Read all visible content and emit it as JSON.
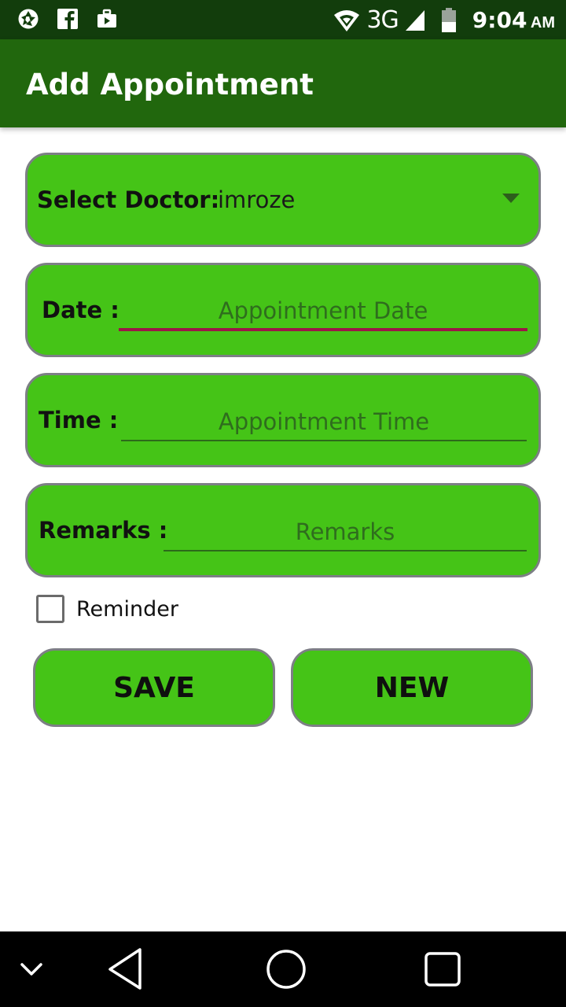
{
  "status_bar": {
    "left_icons": [
      "shutter-icon",
      "facebook-icon",
      "briefcase-icon"
    ],
    "network": "3G",
    "time": "9:04",
    "ampm": "AM",
    "right_icons": [
      "wifi-icon",
      "signal-icon",
      "battery-icon"
    ]
  },
  "app_bar": {
    "title": "Add Appointment"
  },
  "form": {
    "doctor": {
      "label": "Select Doctor:",
      "value": "imroze",
      "icon": "chevron-down-icon"
    },
    "date": {
      "label": "Date :",
      "placeholder": "Appointment Date",
      "value": ""
    },
    "time": {
      "label": "Time :",
      "placeholder": "Appointment Time",
      "value": ""
    },
    "remarks": {
      "label": "Remarks :",
      "placeholder": "Remarks",
      "value": ""
    },
    "reminder": {
      "label": "Reminder",
      "checked": false
    }
  },
  "buttons": {
    "save": "SAVE",
    "new": "NEW"
  },
  "nav_bar": {
    "icons": [
      "collapse-chevron-icon",
      "back-icon",
      "home-icon",
      "recents-icon"
    ]
  },
  "colors": {
    "status_bar": "#123d0c",
    "app_bar": "#21670d",
    "field_bg": "#45c417",
    "field_border": "#7d7f85",
    "focus_underline": "#9b1747"
  }
}
